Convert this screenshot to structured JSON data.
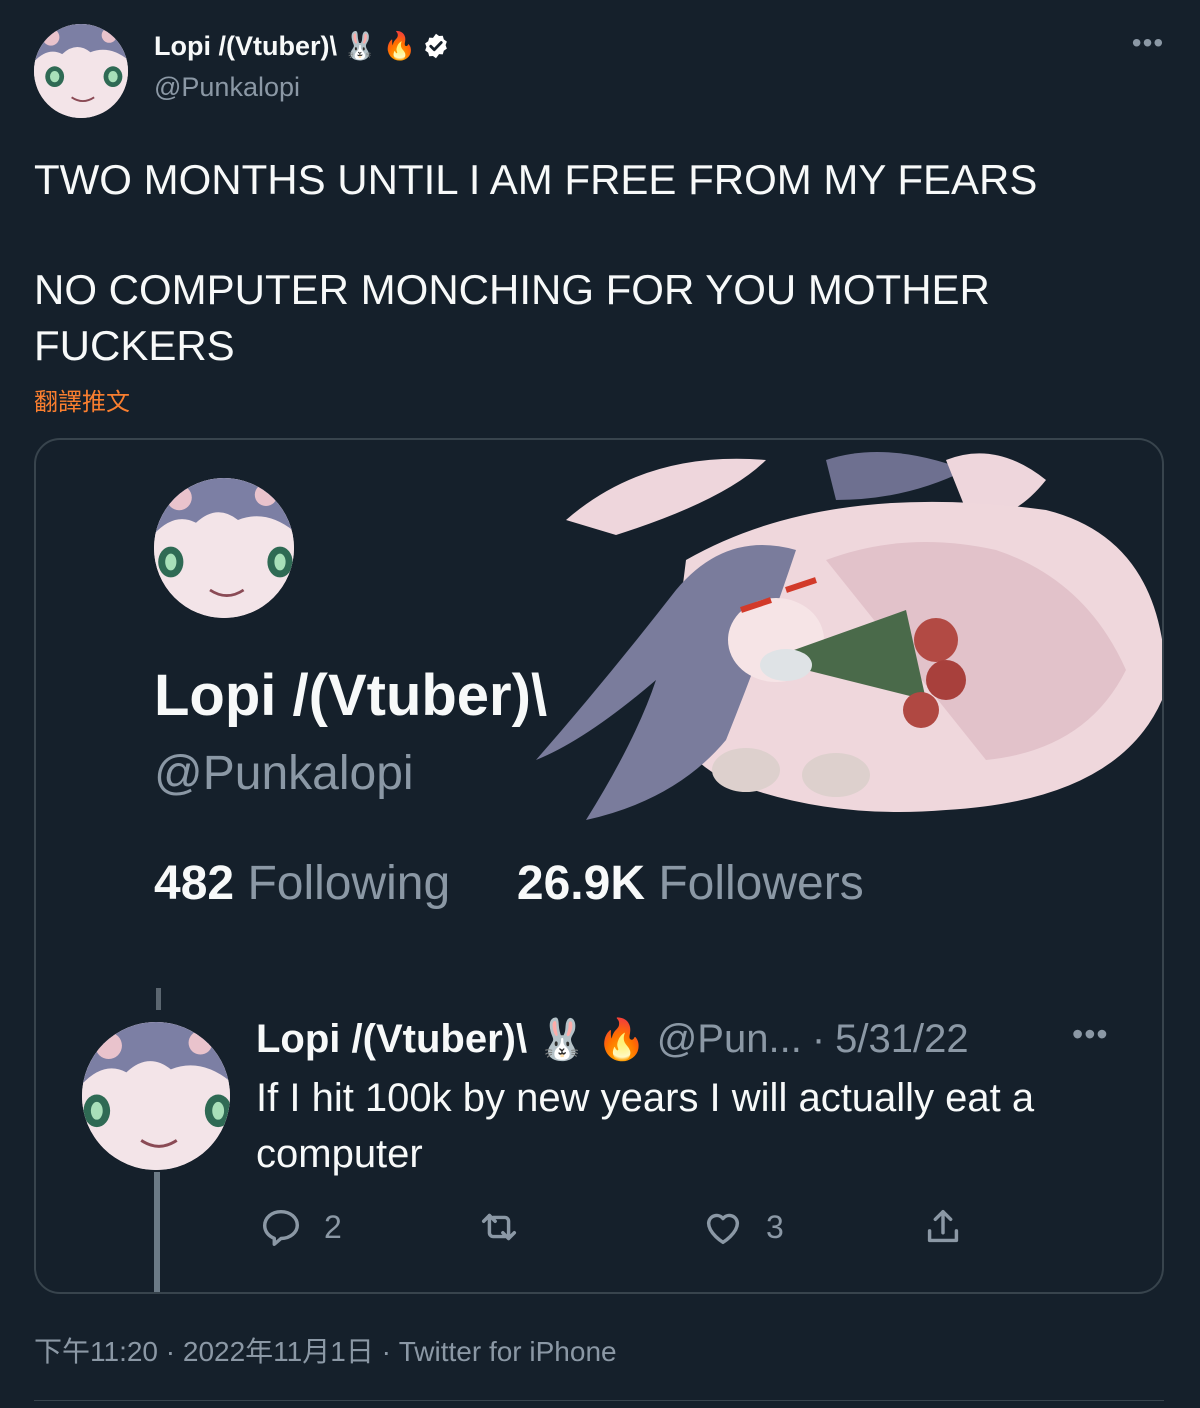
{
  "colors": {
    "background": "#15202b",
    "text": "#f7f9f9",
    "secondary_text": "#8b98a5",
    "translate_link": "#f97e2f",
    "border": "#38444d",
    "verified": "#ffffff"
  },
  "header": {
    "display_name": "Lopi /(Vtuber)\\",
    "handle": "@Punkalopi",
    "name_emojis": [
      "rabbit-face",
      "fire"
    ],
    "verified_icon": "verified-badge-icon",
    "more_icon": "more-icon"
  },
  "tweet": {
    "line1": "TWO MONTHS UNTIL I AM FREE FROM MY FEARS",
    "line2": "NO COMPUTER MONCHING FOR YOU MOTHER",
    "line3": "FUCKERS",
    "translate_label": "翻譯推文"
  },
  "media": {
    "profile_name": "Lopi /(Vtuber)\\",
    "profile_handle": "@Punkalopi",
    "following_count": "482",
    "following_label": "Following",
    "followers_count": "26.9K",
    "followers_label": "Followers",
    "reply": {
      "name": "Lopi /(Vtuber)\\",
      "handle": "@Pun...",
      "separator": "·",
      "date": "5/31/22",
      "text": "If I hit 100k by new years I will actually eat a computer",
      "reply_count": "2",
      "like_count": "3"
    }
  },
  "meta": {
    "time": "下午11:20",
    "sep1": "·",
    "date": "2022年11月1日",
    "sep2": "·",
    "source": "Twitter for iPhone"
  }
}
